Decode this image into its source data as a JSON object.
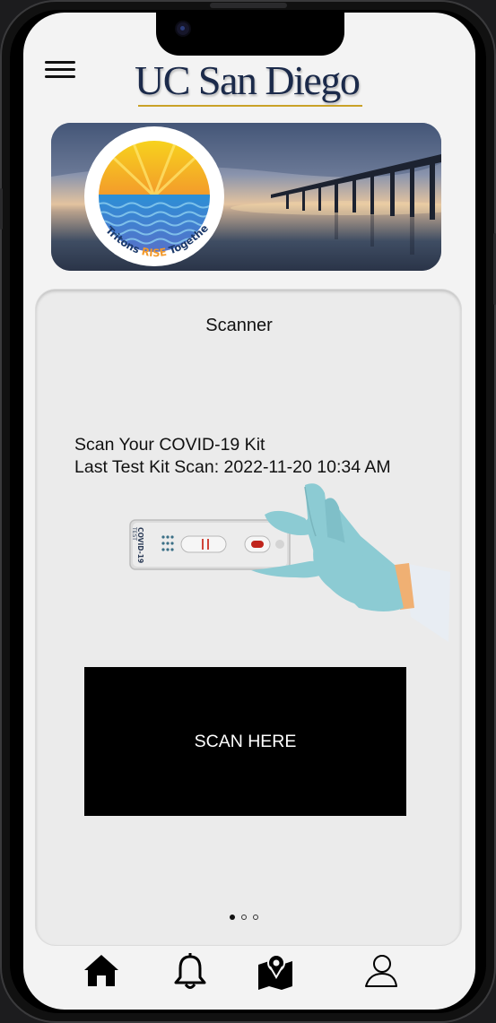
{
  "header": {
    "menu_icon": "hamburger-menu-icon",
    "logo_text": "UC San Diego"
  },
  "banner": {
    "badge_text_pre": "Tritons ",
    "badge_text_rise": "RISE",
    "badge_text_post": " Together"
  },
  "scanner": {
    "title": "Scanner",
    "line1": "Scan Your COVID-19 Kit",
    "line2": "Last Test Kit Scan: 2022-11-20 10:34 AM",
    "kit_label": "COVID-19",
    "kit_sublabel": "TEST",
    "scan_button": "SCAN HERE"
  },
  "pager": {
    "count": 3,
    "active": 0
  },
  "tabbar": {
    "items": [
      {
        "name": "home",
        "icon": "home-icon"
      },
      {
        "name": "notifications",
        "icon": "bell-icon"
      },
      {
        "name": "map",
        "icon": "map-pin-icon"
      },
      {
        "name": "profile",
        "icon": "user-icon"
      }
    ]
  },
  "colors": {
    "logo_navy": "#1b2a4a",
    "logo_gold": "#c9a227",
    "glove": "#8ccbd3",
    "scan_button_bg": "#000000"
  }
}
